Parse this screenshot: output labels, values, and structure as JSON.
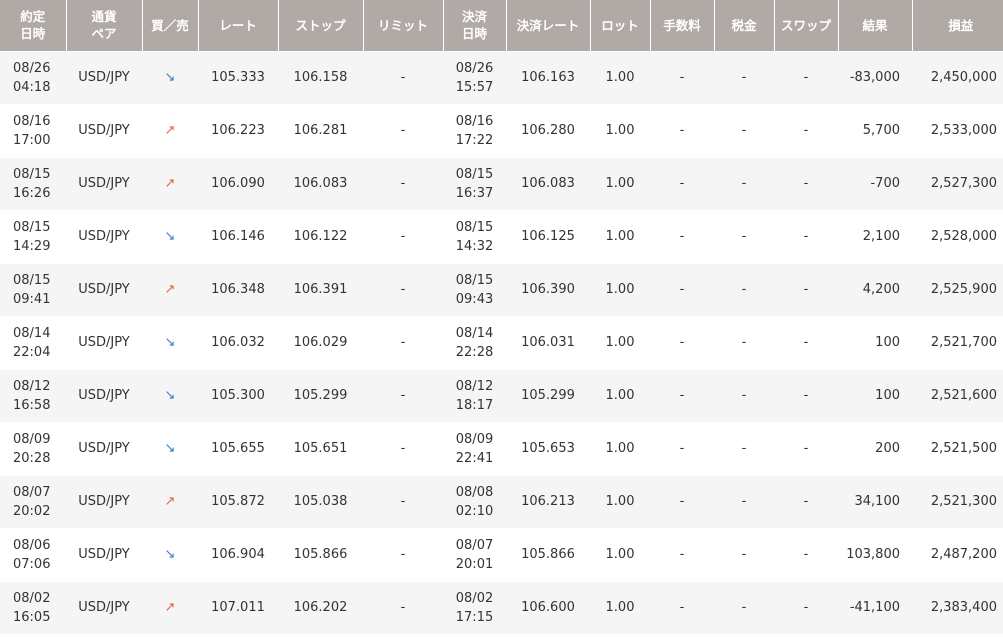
{
  "headers": [
    [
      "約定",
      "日時"
    ],
    [
      "通貨",
      "ペア"
    ],
    [
      "買／売"
    ],
    [
      "レート"
    ],
    [
      "ストップ"
    ],
    [
      "リミット"
    ],
    [
      "決済",
      "日時"
    ],
    [
      "決済レート"
    ],
    [
      "ロット"
    ],
    [
      "手数料"
    ],
    [
      "税金"
    ],
    [
      "スワップ"
    ],
    [
      "結果"
    ],
    [
      "損益"
    ]
  ],
  "icons": {
    "sell": "arrow-down-right-icon",
    "buy": "arrow-up-right-icon"
  },
  "colors": {
    "header_bg": "#b1a9a5",
    "sell_arrow": "#2e7fc8",
    "buy_arrow": "#e2653a"
  },
  "rows": [
    {
      "date": "08/26",
      "time": "04:18",
      "pair": "USD/JPY",
      "side": "sell",
      "side_glyph": "↘",
      "rate": "105.333",
      "stop": "106.158",
      "limit": "-",
      "close_date": "08/26",
      "close_time": "15:57",
      "close_rate": "106.163",
      "lot": "1.00",
      "fee": "-",
      "tax": "-",
      "swap": "-",
      "result": "-83,000",
      "pnl": "2,450,000"
    },
    {
      "date": "08/16",
      "time": "17:00",
      "pair": "USD/JPY",
      "side": "buy",
      "side_glyph": "↗",
      "rate": "106.223",
      "stop": "106.281",
      "limit": "-",
      "close_date": "08/16",
      "close_time": "17:22",
      "close_rate": "106.280",
      "lot": "1.00",
      "fee": "-",
      "tax": "-",
      "swap": "-",
      "result": "5,700",
      "pnl": "2,533,000"
    },
    {
      "date": "08/15",
      "time": "16:26",
      "pair": "USD/JPY",
      "side": "buy",
      "side_glyph": "↗",
      "rate": "106.090",
      "stop": "106.083",
      "limit": "-",
      "close_date": "08/15",
      "close_time": "16:37",
      "close_rate": "106.083",
      "lot": "1.00",
      "fee": "-",
      "tax": "-",
      "swap": "-",
      "result": "-700",
      "pnl": "2,527,300"
    },
    {
      "date": "08/15",
      "time": "14:29",
      "pair": "USD/JPY",
      "side": "sell",
      "side_glyph": "↘",
      "rate": "106.146",
      "stop": "106.122",
      "limit": "-",
      "close_date": "08/15",
      "close_time": "14:32",
      "close_rate": "106.125",
      "lot": "1.00",
      "fee": "-",
      "tax": "-",
      "swap": "-",
      "result": "2,100",
      "pnl": "2,528,000"
    },
    {
      "date": "08/15",
      "time": "09:41",
      "pair": "USD/JPY",
      "side": "buy",
      "side_glyph": "↗",
      "rate": "106.348",
      "stop": "106.391",
      "limit": "-",
      "close_date": "08/15",
      "close_time": "09:43",
      "close_rate": "106.390",
      "lot": "1.00",
      "fee": "-",
      "tax": "-",
      "swap": "-",
      "result": "4,200",
      "pnl": "2,525,900"
    },
    {
      "date": "08/14",
      "time": "22:04",
      "pair": "USD/JPY",
      "side": "sell",
      "side_glyph": "↘",
      "rate": "106.032",
      "stop": "106.029",
      "limit": "-",
      "close_date": "08/14",
      "close_time": "22:28",
      "close_rate": "106.031",
      "lot": "1.00",
      "fee": "-",
      "tax": "-",
      "swap": "-",
      "result": "100",
      "pnl": "2,521,700"
    },
    {
      "date": "08/12",
      "time": "16:58",
      "pair": "USD/JPY",
      "side": "sell",
      "side_glyph": "↘",
      "rate": "105.300",
      "stop": "105.299",
      "limit": "-",
      "close_date": "08/12",
      "close_time": "18:17",
      "close_rate": "105.299",
      "lot": "1.00",
      "fee": "-",
      "tax": "-",
      "swap": "-",
      "result": "100",
      "pnl": "2,521,600"
    },
    {
      "date": "08/09",
      "time": "20:28",
      "pair": "USD/JPY",
      "side": "sell",
      "side_glyph": "↘",
      "rate": "105.655",
      "stop": "105.651",
      "limit": "-",
      "close_date": "08/09",
      "close_time": "22:41",
      "close_rate": "105.653",
      "lot": "1.00",
      "fee": "-",
      "tax": "-",
      "swap": "-",
      "result": "200",
      "pnl": "2,521,500"
    },
    {
      "date": "08/07",
      "time": "20:02",
      "pair": "USD/JPY",
      "side": "buy",
      "side_glyph": "↗",
      "rate": "105.872",
      "stop": "105.038",
      "limit": "-",
      "close_date": "08/08",
      "close_time": "02:10",
      "close_rate": "106.213",
      "lot": "1.00",
      "fee": "-",
      "tax": "-",
      "swap": "-",
      "result": "34,100",
      "pnl": "2,521,300"
    },
    {
      "date": "08/06",
      "time": "07:06",
      "pair": "USD/JPY",
      "side": "sell",
      "side_glyph": "↘",
      "rate": "106.904",
      "stop": "105.866",
      "limit": "-",
      "close_date": "08/07",
      "close_time": "20:01",
      "close_rate": "105.866",
      "lot": "1.00",
      "fee": "-",
      "tax": "-",
      "swap": "-",
      "result": "103,800",
      "pnl": "2,487,200"
    },
    {
      "date": "08/02",
      "time": "16:05",
      "pair": "USD/JPY",
      "side": "buy",
      "side_glyph": "↗",
      "rate": "107.011",
      "stop": "106.202",
      "limit": "-",
      "close_date": "08/02",
      "close_time": "17:15",
      "close_rate": "106.600",
      "lot": "1.00",
      "fee": "-",
      "tax": "-",
      "swap": "-",
      "result": "-41,100",
      "pnl": "2,383,400"
    }
  ]
}
